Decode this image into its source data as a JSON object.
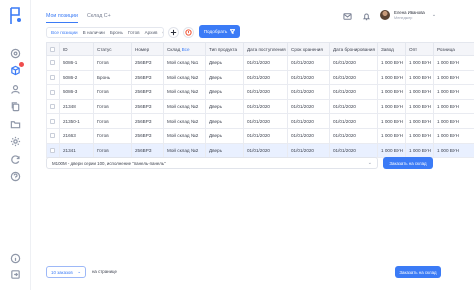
{
  "header": {
    "tabs": [
      {
        "label": "Мои позиции",
        "active": true
      },
      {
        "label": "Склад С+",
        "active": false
      }
    ],
    "user": {
      "name": "Елена Иванова",
      "role": "Менеджер"
    }
  },
  "toolbar": {
    "filter_tabs": [
      {
        "label": "Все позиции",
        "active": true
      },
      {
        "label": "В наличии",
        "active": false
      },
      {
        "label": "Бронь",
        "active": false
      },
      {
        "label": "Готов",
        "active": false
      },
      {
        "label": "Архив",
        "active": false
      },
      {
        "label": "С",
        "active": false
      }
    ],
    "select_button": "Подобрать",
    "accent_color": "#3b7bf6",
    "alert_color": "#f05a3c"
  },
  "table": {
    "columns": [
      "ID",
      "Статус",
      "Номер",
      "Склад",
      "Тип продукта",
      "Дата поступления",
      "Срок хранения",
      "Дата бронирования",
      "Завод",
      "Опт",
      "Розница"
    ],
    "warehouse_column_suffix": "Все",
    "rows": [
      [
        "5086-1",
        "Готов",
        "256ВРЗ",
        "Мой склад №1",
        "Дверь",
        "01/01/2020",
        "01/01/2020",
        "01/01/2020",
        "1 000 ВУН",
        "1 000 ВУН",
        "1 000 ВУН"
      ],
      [
        "5086-2",
        "Бронь",
        "256ВРЗ",
        "Мой склад №2",
        "Дверь",
        "01/01/2020",
        "01/01/2020",
        "01/01/2020",
        "1 000 ВУН",
        "1 000 ВУН",
        "1 000 ВУН"
      ],
      [
        "5086-3",
        "Готов",
        "256ВРЗ",
        "Мой склад №2",
        "Дверь",
        "01/01/2020",
        "01/01/2020",
        "01/01/2020",
        "1 000 ВУН",
        "1 000 ВУН",
        "1 000 ВУН"
      ],
      [
        "21348",
        "Готов",
        "256ВРЗ",
        "Мой склад №2",
        "Дверь",
        "01/01/2020",
        "01/01/2020",
        "01/01/2020",
        "1 000 ВУН",
        "1 000 ВУН",
        "1 000 ВУН"
      ],
      [
        "21350-1",
        "Готов",
        "256ВРЗ",
        "Мой склад №2",
        "Дверь",
        "01/01/2020",
        "01/01/2020",
        "01/01/2020",
        "1 000 ВУН",
        "1 000 ВУН",
        "1 000 ВУН"
      ],
      [
        "21663",
        "Готов",
        "256ВРЗ",
        "Мой склад №2",
        "Дверь",
        "01/01/2020",
        "01/01/2020",
        "01/01/2020",
        "1 000 ВУН",
        "1 000 ВУН",
        "1 000 ВУН"
      ],
      [
        "21341",
        "Готов",
        "256ВРЗ",
        "Мой склад №2",
        "Дверь",
        "01/01/2020",
        "01/01/2020",
        "01/01/2020",
        "1 000 ВУН",
        "1 000 ВУН",
        "1 000 ВУН"
      ]
    ]
  },
  "selection_bar": {
    "text": "М100М - двери серии 100, исполнение \"панель-панель\"",
    "button": "Заказать на склад"
  },
  "footer": {
    "page_size": "10 заказов",
    "per_page_label": "на странице",
    "order_button": "Заказать на склад"
  },
  "rail": {
    "icons": [
      "home-icon",
      "box-icon",
      "user-icon",
      "copy-icon",
      "folder-icon",
      "settings-icon",
      "refresh-icon",
      "help-icon",
      "info-icon",
      "logout-icon"
    ]
  }
}
